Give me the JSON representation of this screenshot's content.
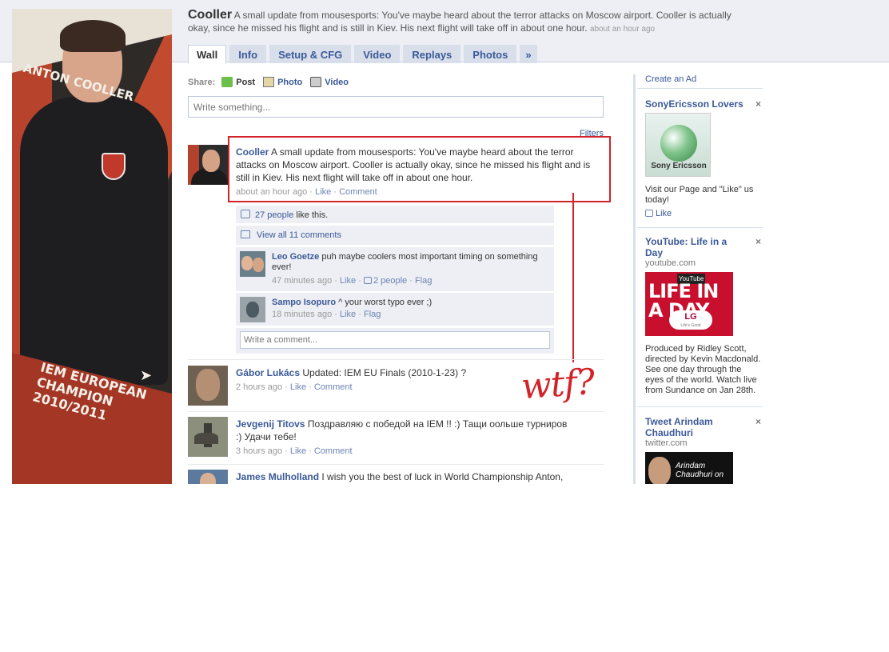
{
  "profile": {
    "name": "Cooller",
    "status": "A small update from mousesports: You've maybe heard about the terror attacks on Moscow airport. Cooller is actually okay, since he missed his flight and is still in Kiev. His next flight will take off in about one hour.",
    "status_time": "about an hour ago",
    "picture_text": {
      "name_line": "ANTON COOLLER",
      "champion_line": "IEM EUROPEAN CHAMPION 2010/2011"
    }
  },
  "tabs": [
    {
      "label": "Wall",
      "active": true
    },
    {
      "label": "Info"
    },
    {
      "label": "Setup & CFG"
    },
    {
      "label": "Video"
    },
    {
      "label": "Replays"
    },
    {
      "label": "Photos"
    },
    {
      "label": "»"
    }
  ],
  "share": {
    "label": "Share:",
    "items": [
      {
        "label": "Post",
        "icon": "post-icon"
      },
      {
        "label": "Photo",
        "icon": "photo-icon"
      },
      {
        "label": "Video",
        "icon": "video-icon"
      }
    ],
    "placeholder": "Write something..."
  },
  "filters_label": "Filters",
  "main_post": {
    "author": "Cooller",
    "text": "A small update from mousesports: You've maybe heard about the terror attacks on Moscow airport. Cooller is actually okay, since he missed his flight and is still in Kiev. His next flight will take off in about one hour.",
    "time": "about an hour ago",
    "like_label": "Like",
    "comment_label": "Comment",
    "likes_count": "27 people",
    "likes_suffix": "like this.",
    "view_all": "View all 11 comments",
    "comments": [
      {
        "author": "Leo Goetze",
        "text": "puh maybe coolers most important timing on something ever!",
        "time": "47 minutes ago",
        "like_label": "Like",
        "likes": "2 people",
        "flag_label": "Flag"
      },
      {
        "author": "Sampo Isopuro",
        "text": "^ your worst typo ever ;)",
        "time": "18 minutes ago",
        "like_label": "Like",
        "flag_label": "Flag"
      }
    ],
    "write_comment_placeholder": "Write a comment..."
  },
  "annotation": "wtf?",
  "stories": [
    {
      "author": "Gábor Lukács",
      "text": "Updated: IEM EU Finals (2010-1-23) ?",
      "time": "2 hours ago",
      "like_label": "Like",
      "comment_label": "Comment"
    },
    {
      "author": "Jevgenij Titovs",
      "text": "Поздравляю с победой на IEM !! :) Тащи оольше турниров :) Удачи тебе!",
      "time": "3 hours ago",
      "like_label": "Like",
      "comment_label": "Comment"
    },
    {
      "author": "James Mulholland",
      "text": "I wish you the best of luck in World Championship Anton,"
    }
  ],
  "sidebar": {
    "create_ad": "Create an Ad",
    "ads": [
      {
        "title": "SonyEricsson Lovers",
        "image_label": "Sony Ericsson",
        "body": "Visit our Page and \"Like\" us today!",
        "like_label": "Like",
        "close": "×"
      },
      {
        "title": "YouTube: Life in a Day",
        "domain": "youtube.com",
        "image_label": "LIFE IN A DAY",
        "image_badge": "YouTube",
        "image_brand": "LG",
        "image_tagline": "Life's Good",
        "body": "Produced by Ridley Scott, directed by Kevin Macdonald. See one day through the eyes of the world. Watch live from Sundance on Jan 28th.",
        "close": "×"
      },
      {
        "title": "Tweet Arindam Chaudhuri",
        "domain": "twitter.com",
        "image_label": "Arindam Chaudhuri on",
        "close": "×"
      }
    ]
  },
  "colors": {
    "link": "#3b5998",
    "annotation_red": "#d2232a",
    "comment_bg": "#edeff4",
    "tab_bg": "#d8dfea"
  }
}
